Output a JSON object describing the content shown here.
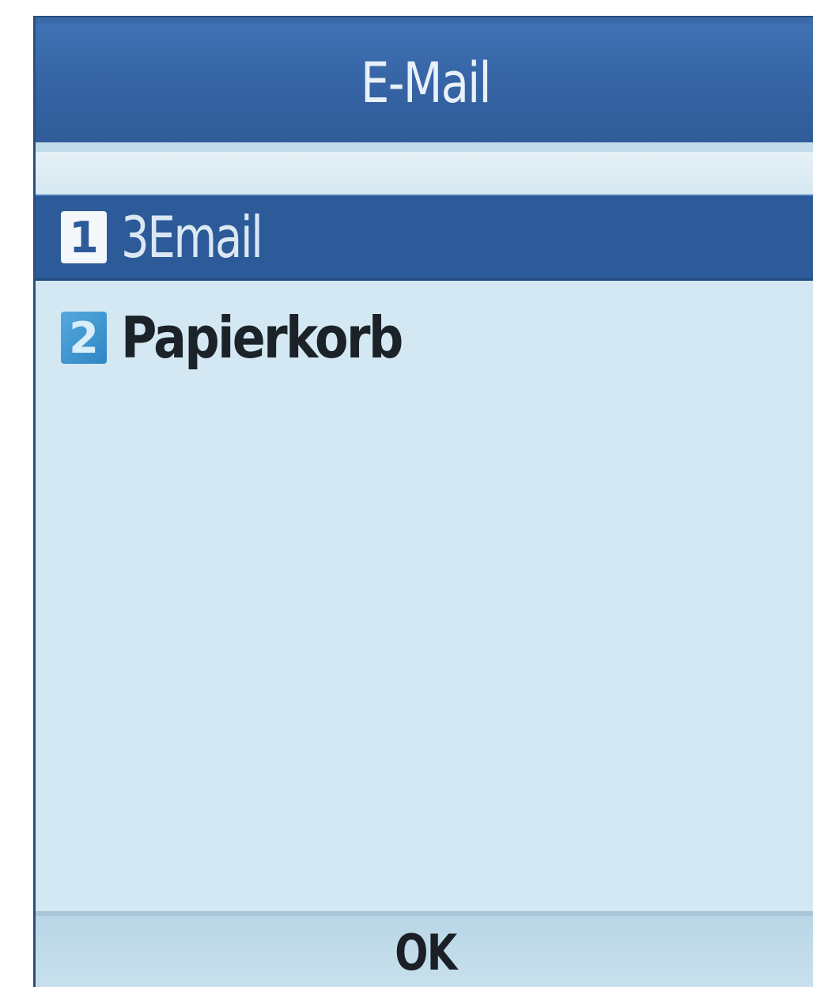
{
  "header": {
    "title": "E-Mail"
  },
  "menu": {
    "items": [
      {
        "number": "1",
        "label": "3Email",
        "selected": true
      },
      {
        "number": "2",
        "label": "Papierkorb",
        "selected": false
      }
    ]
  },
  "softkeys": {
    "center": "OK"
  },
  "colors": {
    "title_bar": "#3563a3",
    "selection": "#2d5a98",
    "background": "#d3e8f2",
    "number_badge": "#2e86c4"
  }
}
